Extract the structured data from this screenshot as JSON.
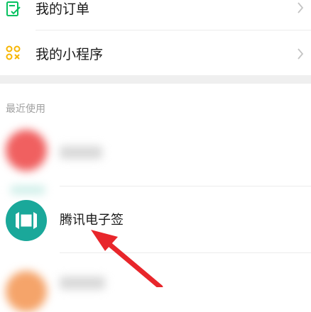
{
  "menu": {
    "orders_label": "我的订单",
    "mini_programs_label": "我的小程序"
  },
  "recent": {
    "section_title": "最近使用",
    "items": [
      {
        "name": "",
        "icon_color": "#f06060"
      },
      {
        "name": "腾讯电子签",
        "icon_color": "#1aa89a"
      },
      {
        "name": "",
        "icon_color": "#f5a46a"
      }
    ]
  },
  "colors": {
    "orders_icon": "#07c160",
    "mini_program_icon": "#f7b500",
    "arrow": "#e8262b"
  }
}
